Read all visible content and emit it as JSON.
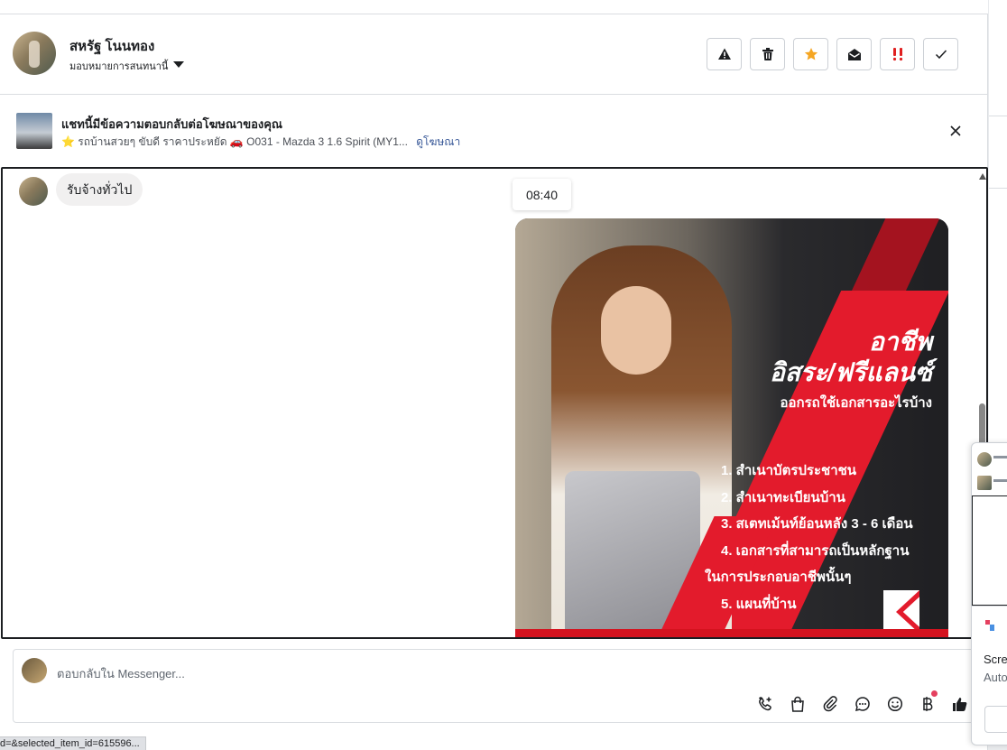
{
  "header": {
    "contact_name": "สหรัฐ โนนทอง",
    "assign_label": "มอบหมายการสนทนานี้",
    "actions": [
      {
        "name": "report-spam",
        "icon": "warning-icon"
      },
      {
        "name": "delete",
        "icon": "trash-icon"
      },
      {
        "name": "star",
        "icon": "star-icon"
      },
      {
        "name": "mark-unread",
        "icon": "envelope-open-icon"
      },
      {
        "name": "follow-up",
        "icon": "exclamation-icon"
      },
      {
        "name": "mark-done",
        "icon": "check-icon"
      }
    ]
  },
  "banner": {
    "title": "แชทนี้มีข้อความตอบกลับต่อโฆษณาของคุณ",
    "subtitle": "⭐ รถบ้านสวยๆ ขับดี ราคาประหยัด 🚗 O031 - Mazda 3 1.6 Spirit (MY1...",
    "link": "ดูโฆษณา"
  },
  "chat": {
    "message": "รับจ้างทั่วไป",
    "timestamp": "08:40",
    "ad_image": {
      "headline1": "อาชีพ",
      "headline2": "อิสระ/ฟรีแลนซ์",
      "subheadline": "ออกรถใช้เอกสารอะไรบ้าง",
      "items": [
        "1. สำเนาบัตรประชาชน",
        "2. สำเนาทะเบียนบ้าน",
        "3. สเตทเม้นท์ย้อนหลัง 3 - 6 เดือน",
        "4. เอกสารที่สามารถเป็นหลักฐาน",
        "ในการประกอบอาชีพนั้นๆ",
        "5. แผนที่บ้าน"
      ]
    }
  },
  "composer": {
    "placeholder": "ตอบกลับใน Messenger..."
  },
  "statusbar": {
    "text": "d=&selected_item_id=615596..."
  },
  "side_popup": {
    "line1": "Scre",
    "line2": "Auto"
  },
  "colors": {
    "accent_link": "#385898",
    "star": "#f5a623",
    "follow_up": "#e02020",
    "ad_red": "#e31b2c"
  }
}
